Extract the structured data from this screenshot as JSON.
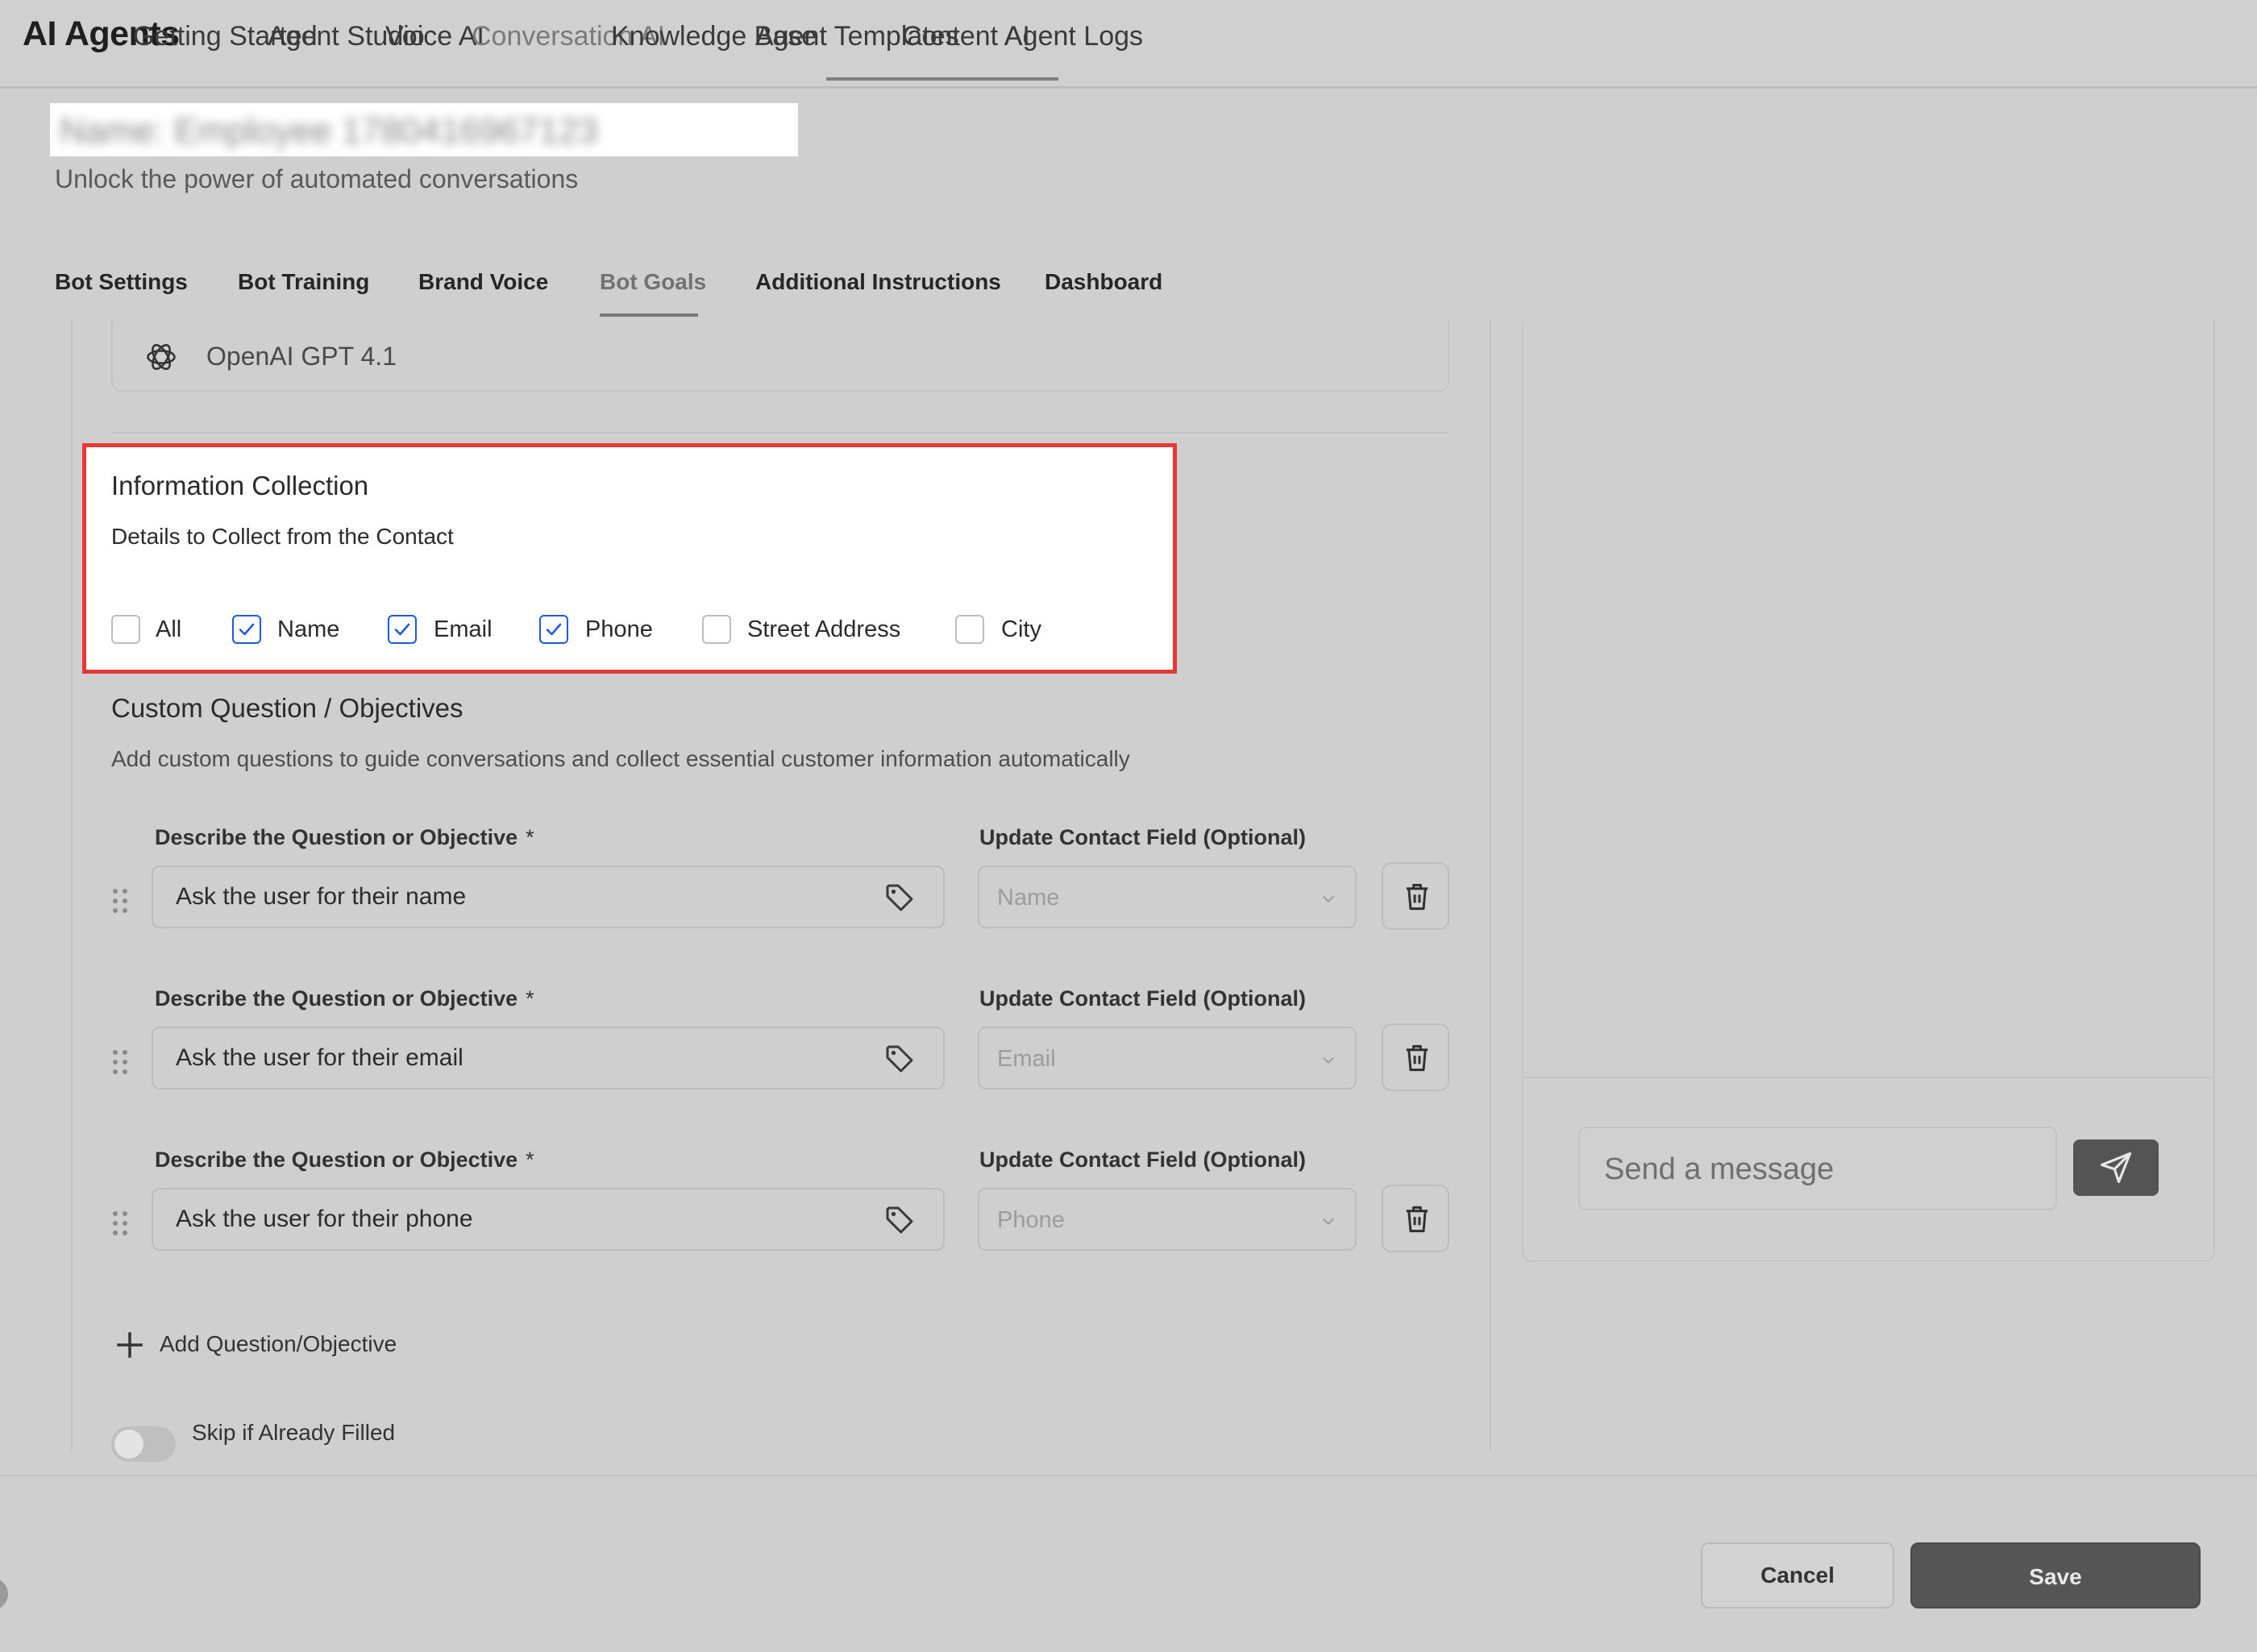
{
  "app": {
    "title": "AI Agents"
  },
  "nav": {
    "tabs": [
      {
        "label": "Getting Started"
      },
      {
        "label": "Agent Studio"
      },
      {
        "label": "Voice AI"
      },
      {
        "label": "Conversation AI",
        "active": true
      },
      {
        "label": "Knowledge Base"
      },
      {
        "label": "Agent Templates"
      },
      {
        "label": "Content AI"
      },
      {
        "label": "Agent Logs"
      }
    ]
  },
  "header": {
    "bot_name": "Name: Employee 1780416967123",
    "subtitle": "Unlock the power of automated conversations"
  },
  "subtabs": [
    {
      "label": "Bot Settings"
    },
    {
      "label": "Bot Training"
    },
    {
      "label": "Brand Voice"
    },
    {
      "label": "Bot Goals",
      "active": true
    },
    {
      "label": "Additional Instructions"
    },
    {
      "label": "Dashboard"
    }
  ],
  "model": {
    "label": "OpenAI GPT 4.1",
    "icon": "openai-icon"
  },
  "info_collection": {
    "title": "Information Collection",
    "subtitle": "Details to Collect from the Contact",
    "options": [
      {
        "label": "All",
        "checked": false
      },
      {
        "label": "Name",
        "checked": true
      },
      {
        "label": "Email",
        "checked": true
      },
      {
        "label": "Phone",
        "checked": true
      },
      {
        "label": "Street Address",
        "checked": false
      },
      {
        "label": "City",
        "checked": false
      }
    ],
    "highlight_color": "#e53935"
  },
  "custom_questions": {
    "title": "Custom Question / Objectives",
    "subtitle": "Add custom questions to guide conversations and collect essential customer information automatically",
    "question_label": "Describe the Question or Objective",
    "required_mark": "*",
    "field_label": "Update Contact Field (Optional)",
    "items": [
      {
        "question": "Ask the user for their name",
        "field": "Name"
      },
      {
        "question": "Ask the user for their email",
        "field": "Email"
      },
      {
        "question": "Ask the user for their phone",
        "field": "Phone"
      }
    ],
    "add_label": "Add Question/Objective",
    "skip_label": "Skip if Already Filled",
    "skip_enabled": false
  },
  "chat": {
    "placeholder": "Send a message"
  },
  "footer": {
    "cancel_label": "Cancel",
    "save_label": "Save"
  },
  "colors": {
    "checkbox_accent": "#1e5bd6",
    "primary_button": "#555555"
  }
}
